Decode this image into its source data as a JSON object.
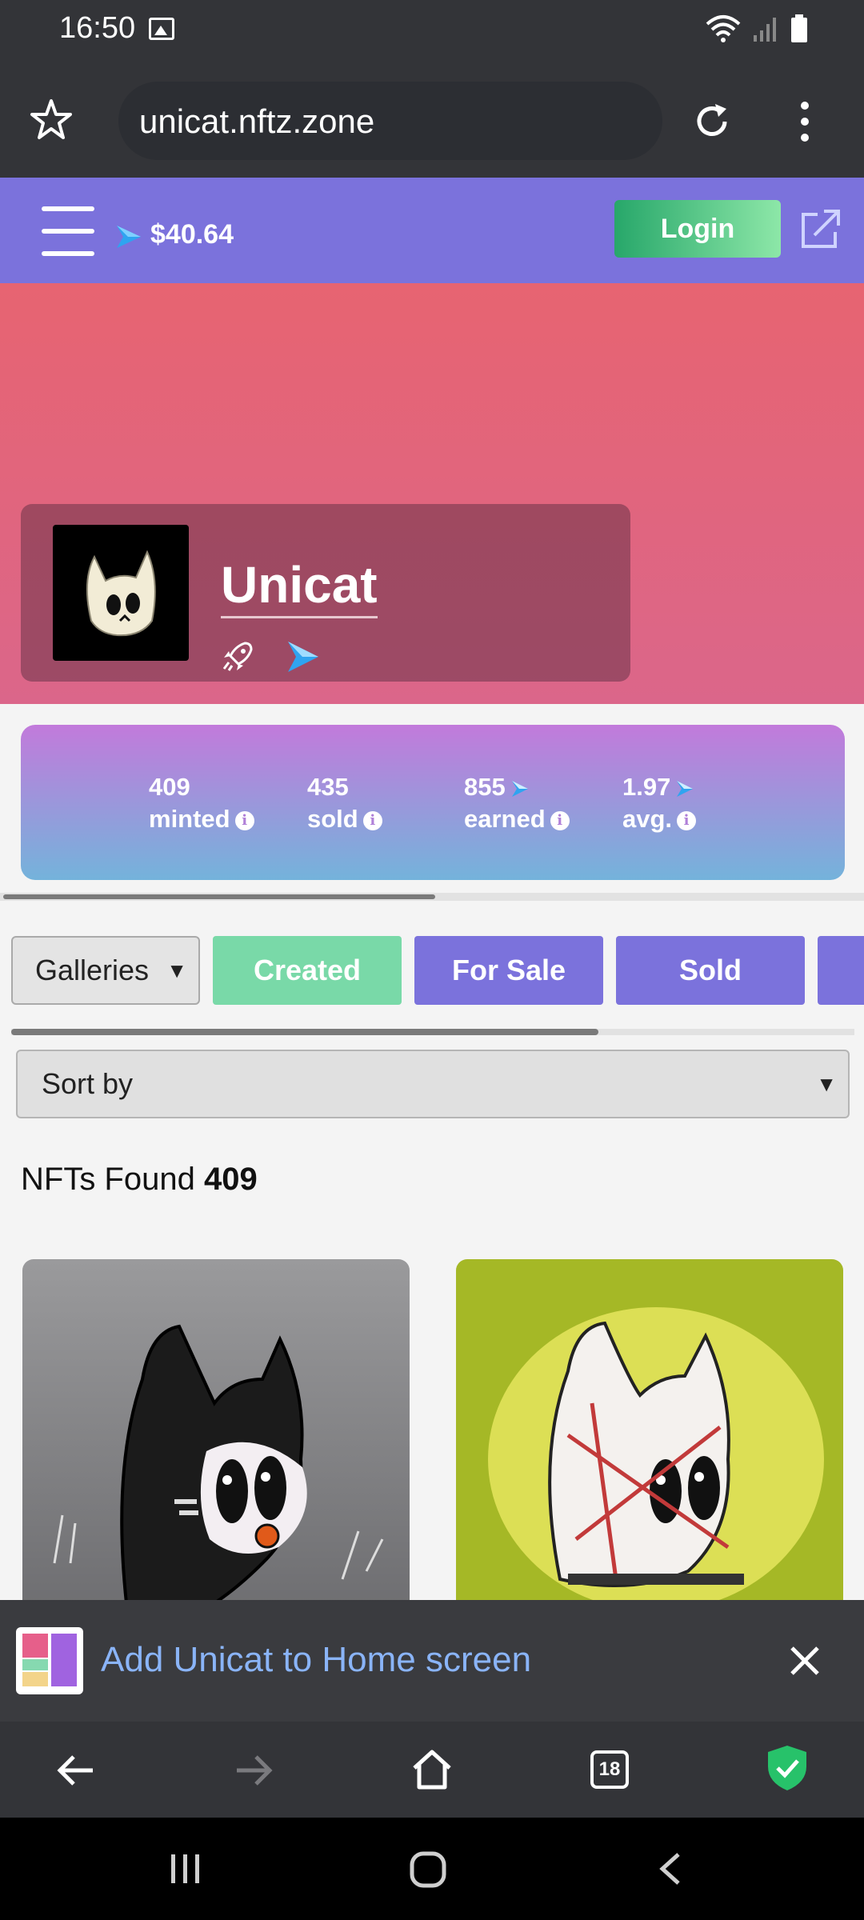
{
  "status_bar": {
    "time": "16:50"
  },
  "browser": {
    "url": "unicat.nftz.zone",
    "tab_count": "18"
  },
  "site_header": {
    "balance": "$40.64",
    "login_label": "Login"
  },
  "profile": {
    "name": "Unicat"
  },
  "stats": [
    {
      "value": "409",
      "label": "minted",
      "has_currency_icon": false
    },
    {
      "value": "435",
      "label": "sold",
      "has_currency_icon": false
    },
    {
      "value": "855",
      "label": "earned",
      "has_currency_icon": true
    },
    {
      "value": "1.97",
      "label": "avg.",
      "has_currency_icon": true
    }
  ],
  "filters": {
    "galleries_label": "Galleries",
    "tabs": [
      {
        "label": "Created",
        "active": true
      },
      {
        "label": "For Sale",
        "active": false
      },
      {
        "label": "Sold",
        "active": false
      }
    ],
    "sort_label": "Sort by"
  },
  "results": {
    "prefix": "NFTs Found",
    "count": "409"
  },
  "install_prompt": {
    "text": "Add Unicat to Home screen"
  },
  "colors": {
    "header_purple": "#7b72dc",
    "active_tab_green": "#79d9a8",
    "tab_purple": "#7b72dc",
    "link_blue": "#8ab4f8"
  }
}
